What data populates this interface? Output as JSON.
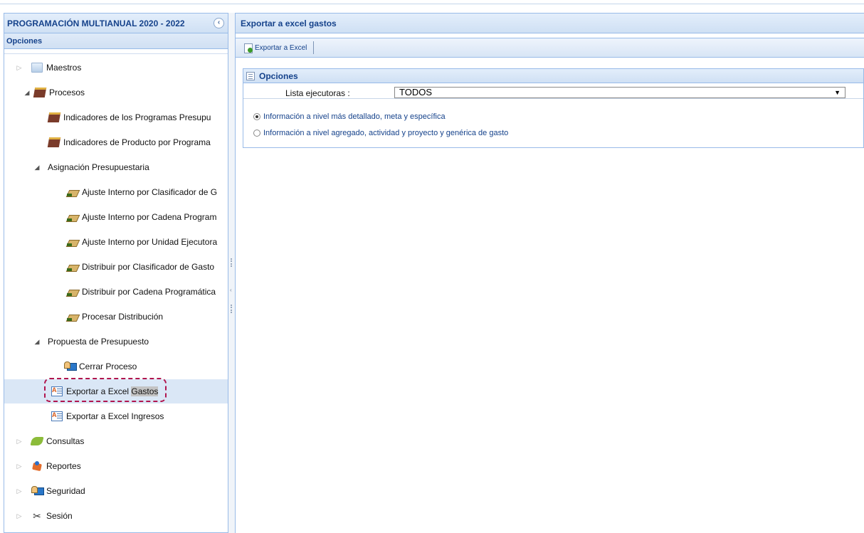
{
  "left_panel": {
    "title": "PROGRAMACIÓN MULTIANUAL 2020 - 2022",
    "collapse_icon": "chevron-left-icon",
    "section_title": "Opciones",
    "tree": [
      {
        "label": "Maestros",
        "icon": "folder-icon",
        "arrow": "▷"
      },
      {
        "label": "Procesos",
        "icon": "book-icon",
        "arrow": "◢"
      },
      {
        "label": "Indicadores de los Programas Presupu",
        "icon": "book-icon",
        "arrow": ""
      },
      {
        "label": "Indicadores de Producto por Programa",
        "icon": "book-icon",
        "arrow": ""
      },
      {
        "label": "Asignación Presupuestaria",
        "icon": "",
        "arrow": "◢"
      },
      {
        "label": "Ajuste Interno por Clasificador de G",
        "icon": "pencil-icon",
        "arrow": ""
      },
      {
        "label": "Ajuste Interno por Cadena Program",
        "icon": "pencil-icon",
        "arrow": ""
      },
      {
        "label": "Ajuste Interno por Unidad Ejecutora",
        "icon": "pencil-icon",
        "arrow": ""
      },
      {
        "label": "Distribuir por Clasificador de Gasto",
        "icon": "pencil-icon",
        "arrow": ""
      },
      {
        "label": "Distribuir por Cadena Programática",
        "icon": "pencil-icon",
        "arrow": ""
      },
      {
        "label": "Procesar Distribución",
        "icon": "pencil-icon",
        "arrow": ""
      },
      {
        "label": "Propuesta de Presupuesto",
        "icon": "",
        "arrow": "◢"
      },
      {
        "label": "Cerrar Proceso",
        "icon": "monitor-icon",
        "arrow": ""
      },
      {
        "label_a": "Exportar a Excel ",
        "label_b": "Gastos",
        "icon": "excel-icon",
        "arrow": ""
      },
      {
        "label": "Exportar a Excel Ingresos",
        "icon": "excel-icon",
        "arrow": ""
      },
      {
        "label": "Consultas",
        "icon": "grass-icon",
        "arrow": "▷"
      },
      {
        "label": "Reportes",
        "icon": "report-icon",
        "arrow": "▷"
      },
      {
        "label": "Seguridad",
        "icon": "monitor-icon",
        "arrow": "▷"
      },
      {
        "label": "Sesión",
        "icon": "tools-icon",
        "arrow": "▷"
      }
    ]
  },
  "right_panel": {
    "title": "Exportar a excel gastos",
    "toolbar": {
      "export_label": "Exportar a Excel"
    },
    "options": {
      "title": "Opciones",
      "ejecutoras_label": "Lista ejecutoras :",
      "ejecutoras_value": "TODOS",
      "radio_detailed": "Información a nivel más detallado, meta y específica",
      "radio_aggregate": "Información a nivel agregado, actividad y proyecto y genérica de gasto"
    }
  },
  "colors": {
    "accent": "#15428b",
    "border": "#99bbe8",
    "highlight": "#b0154e"
  }
}
